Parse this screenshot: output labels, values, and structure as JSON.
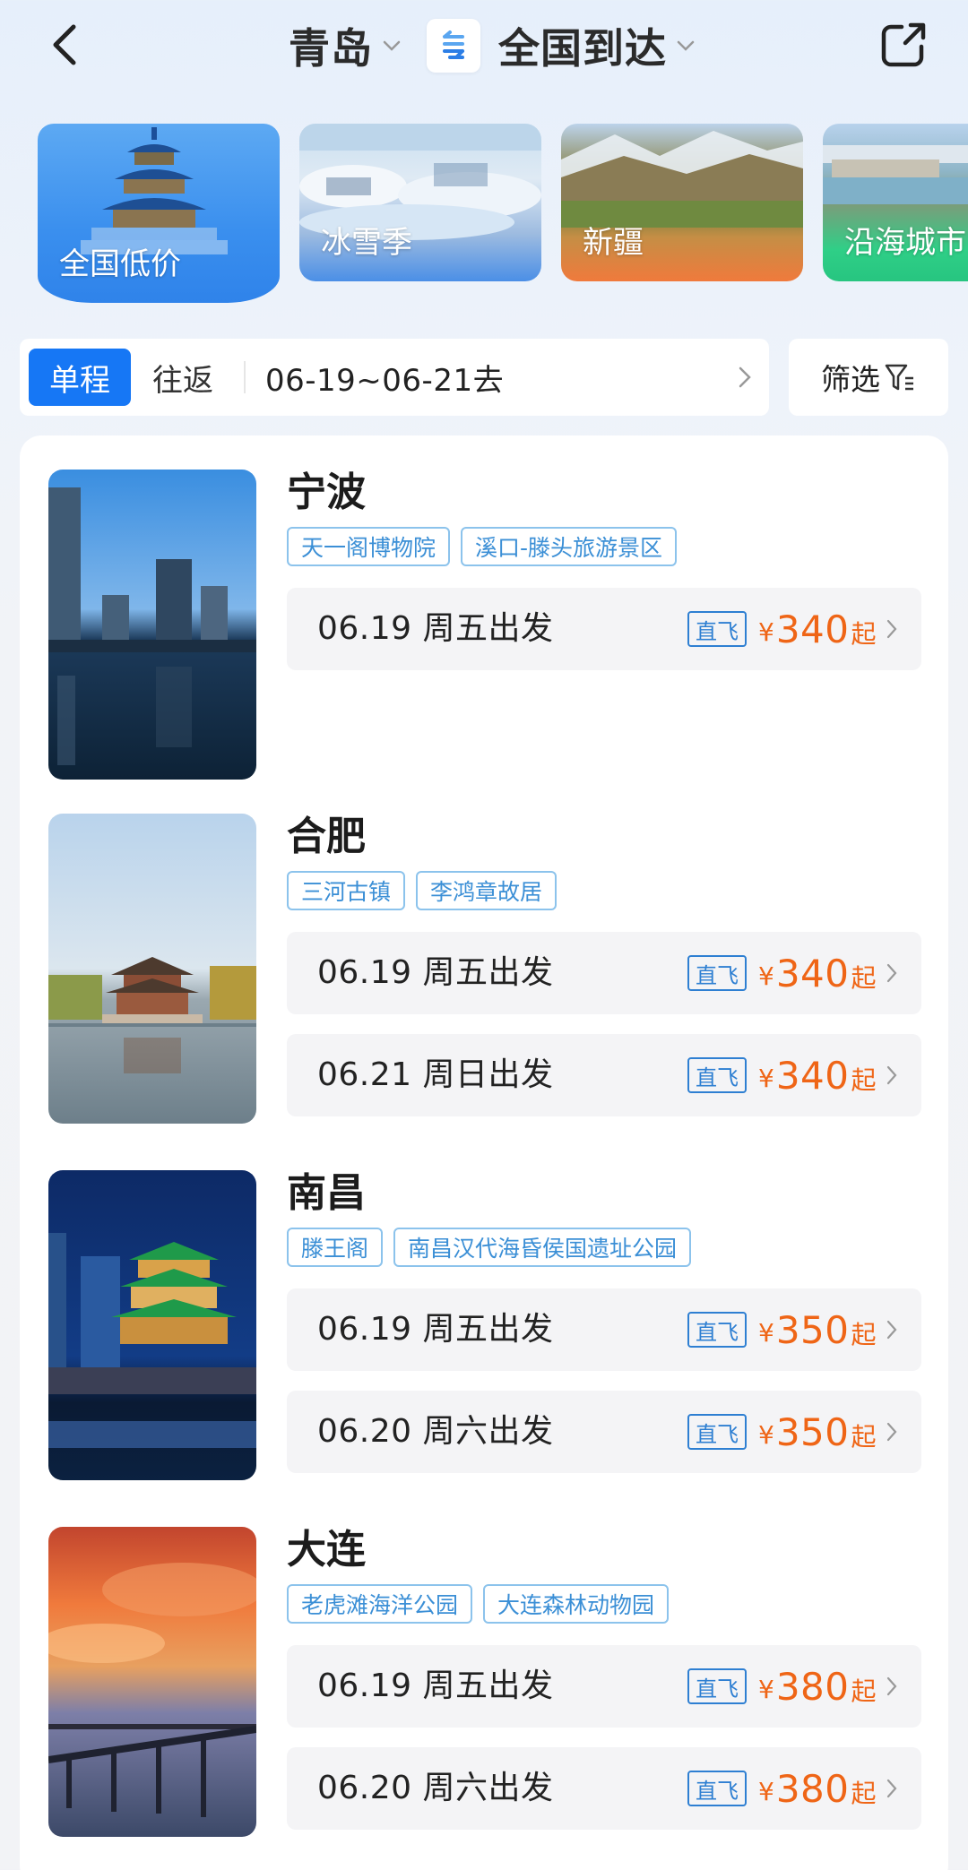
{
  "header": {
    "origin": "青岛",
    "destination": "全国到达"
  },
  "categories": [
    {
      "label": "全国低价"
    },
    {
      "label": "冰雪季"
    },
    {
      "label": "新疆"
    },
    {
      "label": "沿海城市"
    }
  ],
  "tripbar": {
    "one_way": "单程",
    "round_trip": "往返",
    "dates": "06-19~06-21去",
    "filter": "筛选"
  },
  "destinations": [
    {
      "name": "宁波",
      "tags": [
        "天一阁博物院",
        "溪口-滕头旅游景区"
      ],
      "flights": [
        {
          "date": "06.19 周五出发",
          "badge": "直飞",
          "currency": "¥",
          "price": "340",
          "suffix": "起"
        }
      ]
    },
    {
      "name": "合肥",
      "tags": [
        "三河古镇",
        "李鸿章故居"
      ],
      "flights": [
        {
          "date": "06.19 周五出发",
          "badge": "直飞",
          "currency": "¥",
          "price": "340",
          "suffix": "起"
        },
        {
          "date": "06.21 周日出发",
          "badge": "直飞",
          "currency": "¥",
          "price": "340",
          "suffix": "起"
        }
      ]
    },
    {
      "name": "南昌",
      "tags": [
        "滕王阁",
        "南昌汉代海昏侯国遗址公园"
      ],
      "flights": [
        {
          "date": "06.19 周五出发",
          "badge": "直飞",
          "currency": "¥",
          "price": "350",
          "suffix": "起"
        },
        {
          "date": "06.20 周六出发",
          "badge": "直飞",
          "currency": "¥",
          "price": "350",
          "suffix": "起"
        }
      ]
    },
    {
      "name": "大连",
      "tags": [
        "老虎滩海洋公园",
        "大连森林动物园"
      ],
      "flights": [
        {
          "date": "06.19 周五出发",
          "badge": "直飞",
          "currency": "¥",
          "price": "380",
          "suffix": "起"
        },
        {
          "date": "06.20 周六出发",
          "badge": "直飞",
          "currency": "¥",
          "price": "380",
          "suffix": "起"
        }
      ]
    }
  ],
  "colors": {
    "accent": "#1677f5",
    "price": "#ef6516",
    "tag": "#3b8fd6"
  },
  "icons": [
    "back-arrow-icon",
    "caret-down-icon",
    "swap-icon",
    "share-icon",
    "chevron-right-icon",
    "filter-icon"
  ]
}
